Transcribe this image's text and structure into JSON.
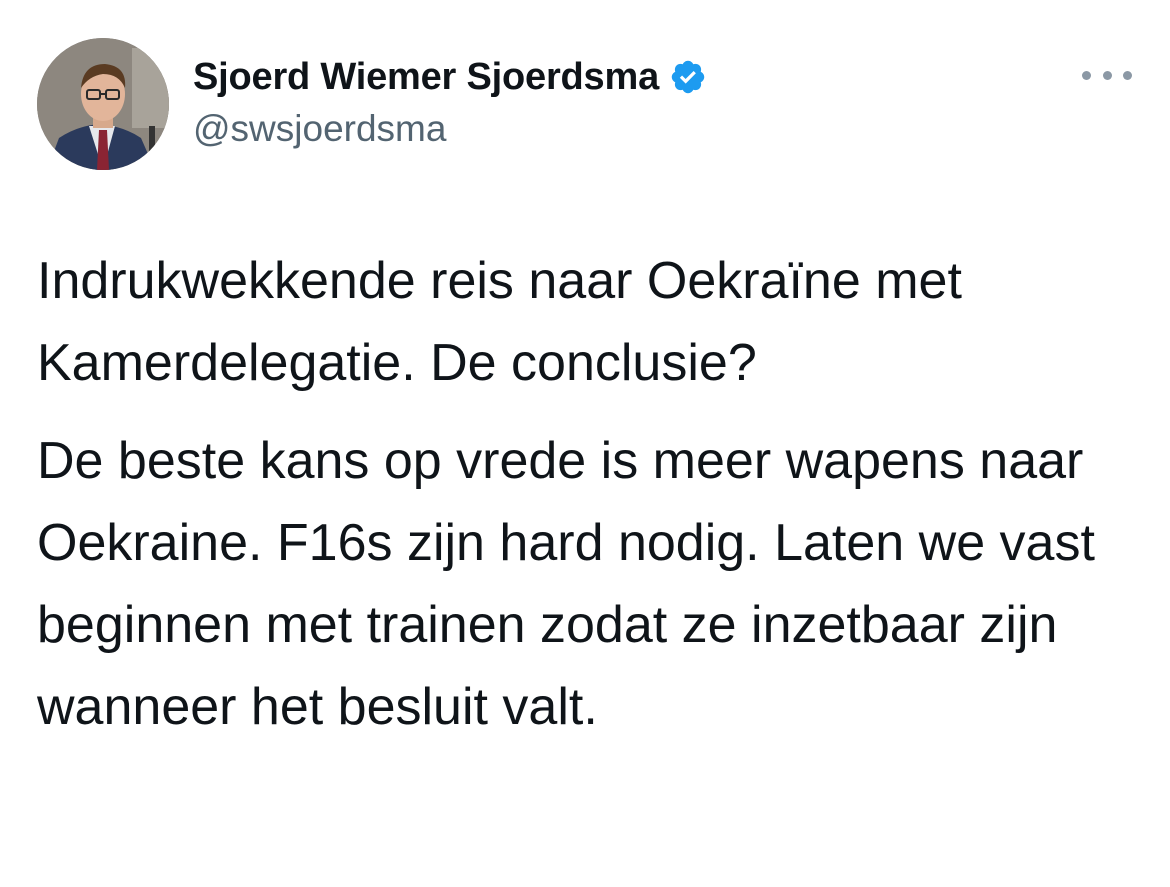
{
  "author": {
    "display_name": "Sjoerd Wiemer Sjoerdsma",
    "handle": "@swsjoerdsma",
    "verified": true,
    "avatar_icon": "profile-photo"
  },
  "menu": {
    "icon": "more-options-icon"
  },
  "tweet": {
    "paragraphs": [
      "Indrukwekkende reis naar Oekraïne met Kamerdelegatie. De conclusie?",
      "De beste kans op vrede is meer wapens naar Oekraine. F16s zijn hard nodig. Laten we vast beginnen met trainen zodat ze inzetbaar zijn wanneer het besluit valt."
    ]
  },
  "colors": {
    "verified_badge": "#1d9bf0",
    "text_primary": "#0f1419",
    "text_secondary": "#536471"
  }
}
